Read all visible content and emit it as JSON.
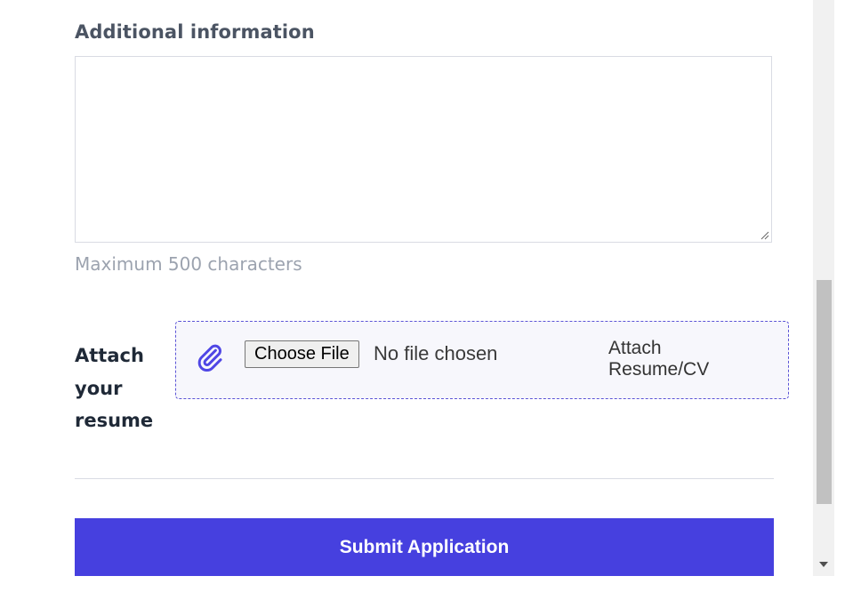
{
  "form": {
    "additional_label": "Additional information",
    "textarea_value": "",
    "hint": "Maximum 500 characters",
    "attach_label": "Attach your resume",
    "choose_file_label": "Choose File",
    "no_file_text": "No file chosen",
    "attach_resume_label": "Attach Resume/CV",
    "submit_label": "Submit Application"
  },
  "colors": {
    "accent": "#4640df",
    "dropzone_border": "#5b54d6",
    "clip_icon": "#4f46e5"
  },
  "icons": {
    "attach": "paperclip-icon"
  }
}
